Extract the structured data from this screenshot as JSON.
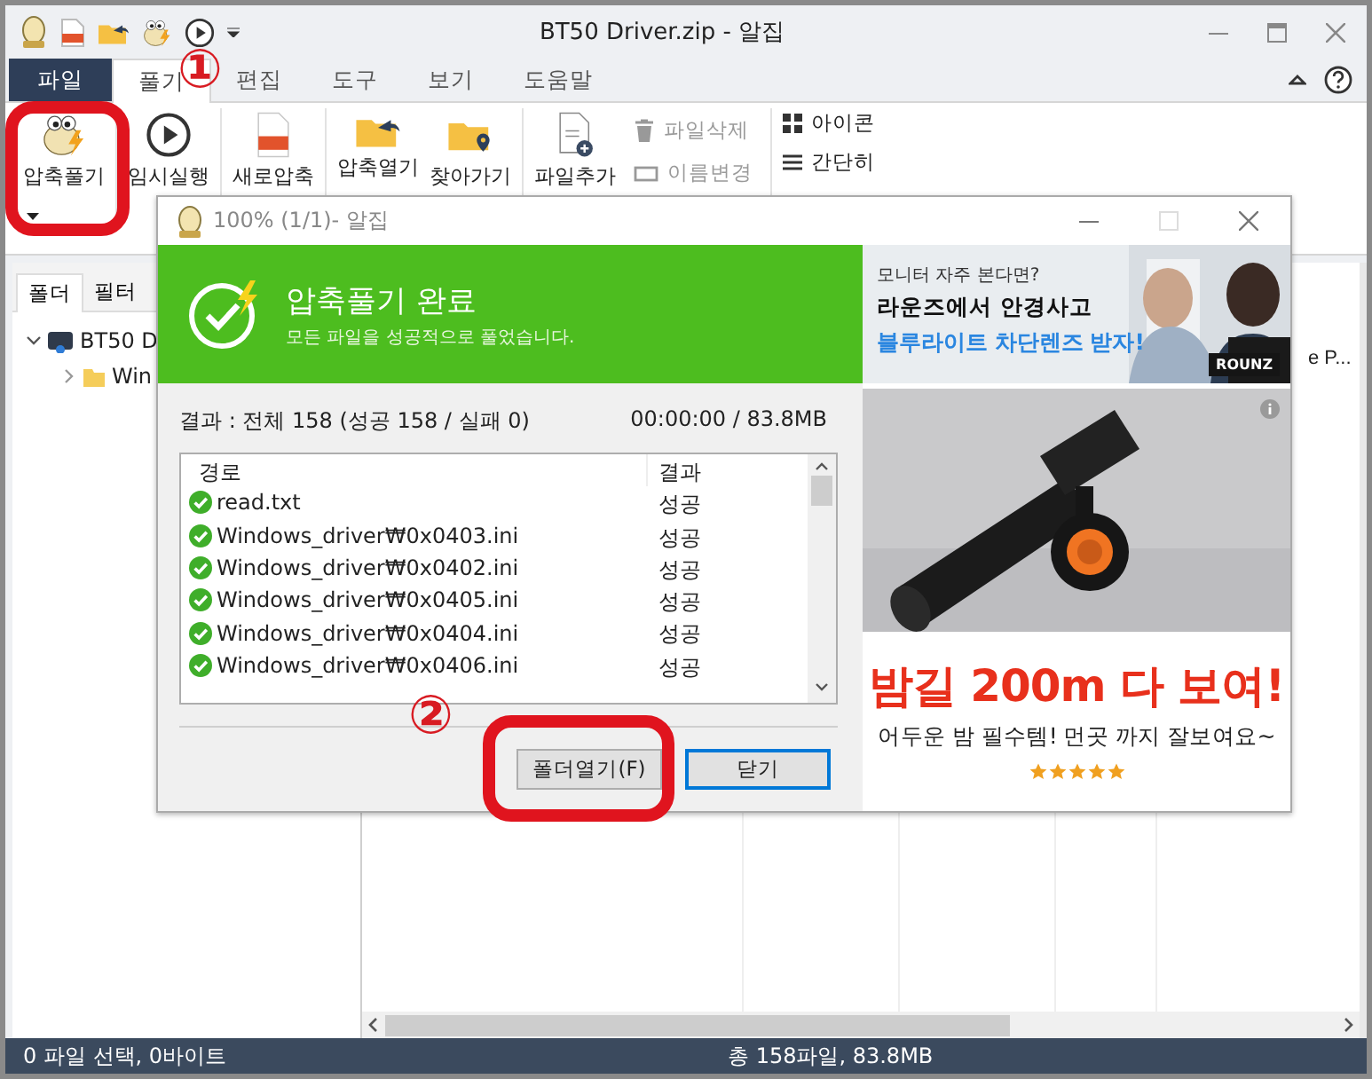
{
  "window": {
    "title": "BT50 Driver.zip - 알집"
  },
  "menu_tabs": [
    {
      "label": "파일",
      "kind": "file",
      "selected": false
    },
    {
      "label": "풀기",
      "kind": "tab",
      "selected": true
    },
    {
      "label": "편집",
      "kind": "tab",
      "selected": false
    },
    {
      "label": "도구",
      "kind": "tab",
      "selected": false
    },
    {
      "label": "보기",
      "kind": "tab",
      "selected": false
    },
    {
      "label": "도움말",
      "kind": "tab",
      "selected": false
    }
  ],
  "ribbon": {
    "groups": [
      [
        {
          "label": "압축풀기",
          "dropdown": true
        }
      ],
      [
        {
          "label": "임시실행",
          "dropdown": false
        }
      ],
      [
        {
          "label": "새로압축",
          "dropdown": false
        }
      ],
      [
        {
          "label": "압축열기",
          "dropdown": false
        },
        {
          "label": "찾아가기",
          "dropdown": false
        }
      ],
      [
        {
          "label": "파일추가",
          "dropdown": false
        }
      ]
    ],
    "small_items": [
      {
        "label": "파일삭제",
        "disabled": true
      },
      {
        "label": "이름변경",
        "disabled": true
      }
    ],
    "view_items": [
      {
        "label": "아이콘"
      },
      {
        "label": "간단히"
      }
    ]
  },
  "side_tabs": [
    {
      "label": "폴더",
      "selected": true
    },
    {
      "label": "필터",
      "selected": false
    }
  ],
  "tree": [
    {
      "label": "BT50 D",
      "kind": "zip",
      "expanded": true,
      "children": [
        {
          "label": "Win",
          "kind": "folder",
          "expanded": false
        }
      ]
    }
  ],
  "file_list": {
    "visible_cell": "e P..."
  },
  "status_bar": {
    "left": "0 파일 선택, 0바이트",
    "center": "총 158파일, 83.8MB"
  },
  "dialog": {
    "title": "100% (1/1)- 알집",
    "header": {
      "title": "압축풀기 완료",
      "subtitle": "모든 파일을 성공적으로 풀었습니다."
    },
    "summary": "결과 : 전체 158 (성공 158 / 실패 0)",
    "elapsed": "00:00:00 / 83.8MB",
    "columns": [
      "경로",
      "결과"
    ],
    "rows": [
      {
        "path": "read.txt",
        "result": "성공"
      },
      {
        "path": "Windows_driver₩0x0403.ini",
        "result": "성공"
      },
      {
        "path": "Windows_driver₩0x0402.ini",
        "result": "성공"
      },
      {
        "path": "Windows_driver₩0x0405.ini",
        "result": "성공"
      },
      {
        "path": "Windows_driver₩0x0404.ini",
        "result": "성공"
      },
      {
        "path": "Windows_driver₩0x0406.ini",
        "result": "성공"
      }
    ],
    "buttons": [
      {
        "label": "폴더열기(F)",
        "default": false
      },
      {
        "label": "닫기",
        "default": true
      }
    ],
    "ad": {
      "banner": {
        "line1": "모니터 자주 본다면?",
        "line2": "라운즈에서 안경사고",
        "line3": "블루라이트 차단렌즈 받자!",
        "logo": "ROUNZ"
      },
      "headline": "밤길 200m 다 보여!",
      "tagline": "어두운 밤 필수템! 먼곳 까지 잘보여요~",
      "stars": 5
    }
  },
  "annotations": [
    "①",
    "②"
  ]
}
